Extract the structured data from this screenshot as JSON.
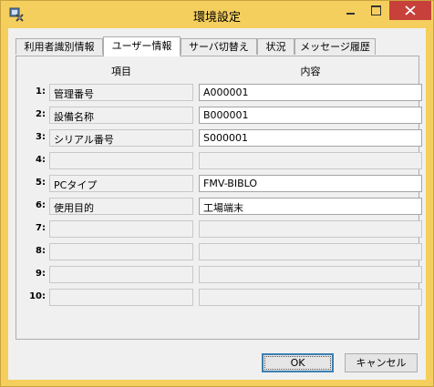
{
  "window": {
    "title": "環境設定"
  },
  "tabs": [
    {
      "label": "利用者識別情報"
    },
    {
      "label": "ユーザー情報"
    },
    {
      "label": "サーバ切替え"
    },
    {
      "label": "状況"
    },
    {
      "label": "メッセージ履歴"
    }
  ],
  "active_tab": "ユーザー情報",
  "table": {
    "headers": {
      "item": "項目",
      "content": "内容"
    },
    "rows": [
      {
        "num": "1:",
        "item": "管理番号",
        "value": "A000001"
      },
      {
        "num": "2:",
        "item": "設備名称",
        "value": "B000001"
      },
      {
        "num": "3:",
        "item": "シリアル番号",
        "value": "S000001"
      },
      {
        "num": "4:",
        "item": "",
        "value": ""
      },
      {
        "num": "5:",
        "item": "PCタイプ",
        "value": "FMV-BIBLO"
      },
      {
        "num": "6:",
        "item": "使用目的",
        "value": "工場端末"
      },
      {
        "num": "7:",
        "item": "",
        "value": ""
      },
      {
        "num": "8:",
        "item": "",
        "value": ""
      },
      {
        "num": "9:",
        "item": "",
        "value": ""
      },
      {
        "num": "10:",
        "item": "",
        "value": ""
      }
    ]
  },
  "buttons": {
    "ok": "OK",
    "cancel": "キャンセル"
  },
  "colors": {
    "title_bar": "#f5cf5e",
    "close_button": "#c7403a",
    "default_button_border": "#3c7fb1"
  }
}
